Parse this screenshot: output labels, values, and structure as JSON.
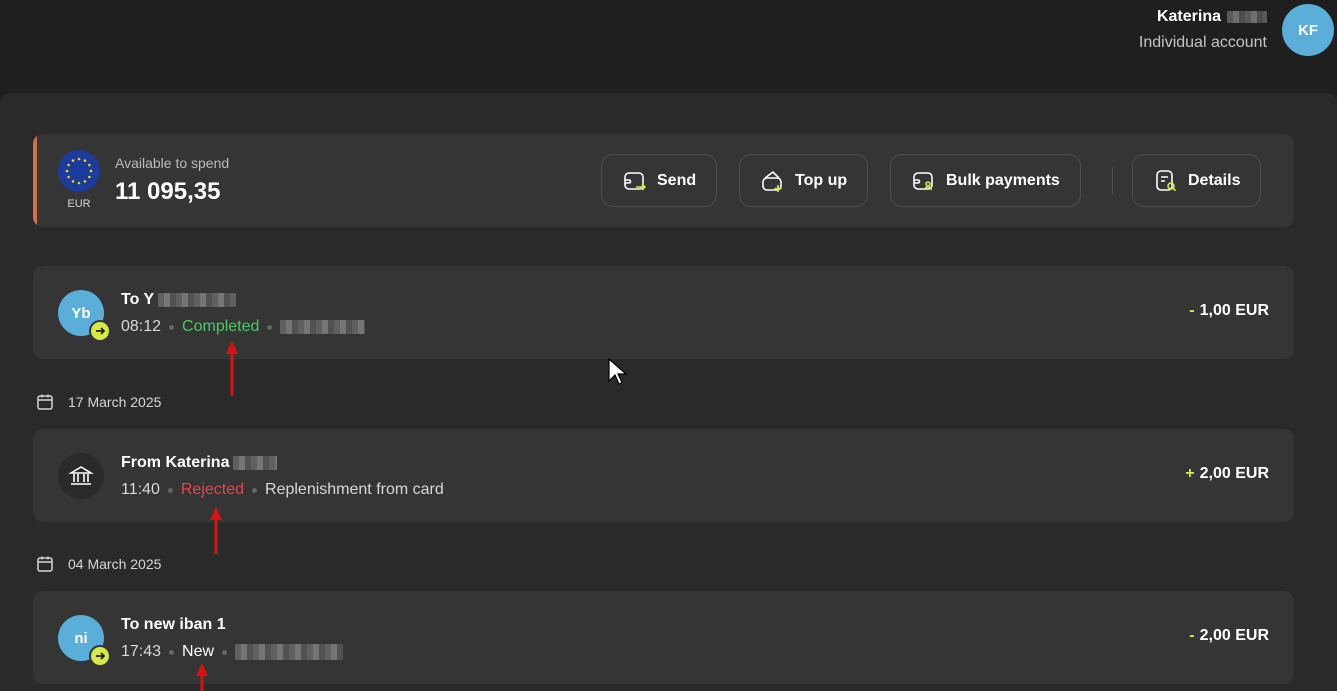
{
  "user": {
    "name": "Katerina",
    "account_type": "Individual account",
    "initials": "KF"
  },
  "balance": {
    "currency_code": "EUR",
    "available_label": "Available to spend",
    "amount": "11 095,35",
    "accent_color": "#d1704a"
  },
  "actions": {
    "send": "Send",
    "top_up": "Top up",
    "bulk_payments": "Bulk payments",
    "details": "Details"
  },
  "transactions": [
    {
      "initials": "Yb",
      "title": "To Y",
      "time": "08:12",
      "status": "Completed",
      "sign": "-",
      "amount": "1,00 EUR"
    },
    {
      "date": "17 March 2025",
      "icon": "bank-icon",
      "title": "From Katerina",
      "time": "11:40",
      "status": "Rejected",
      "description": "Replenishment from card",
      "sign": "+",
      "amount": "2,00 EUR"
    },
    {
      "date": "04 March 2025",
      "initials": "ni",
      "title": "To new iban 1",
      "time": "17:43",
      "status": "New",
      "sign": "-",
      "amount": "2,00 EUR"
    }
  ],
  "colors": {
    "completed": "#4cc866",
    "rejected": "#e34646",
    "accent_yellow": "#d7e84a",
    "avatar_blue": "#5aaed8"
  }
}
